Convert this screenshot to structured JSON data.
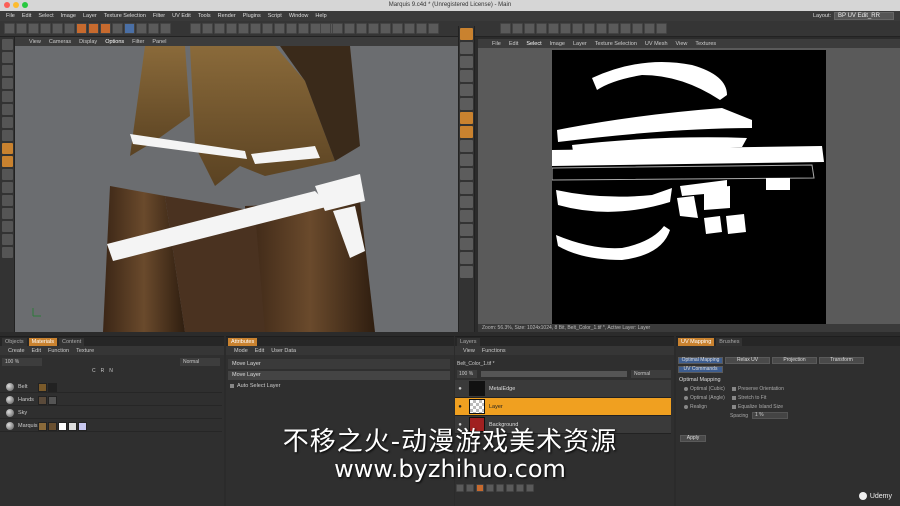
{
  "window": {
    "title": "Marquis 9.c4d * (Unregistered License) - Main"
  },
  "menubar": {
    "items": [
      "File",
      "Edit",
      "Select",
      "Image",
      "Layer",
      "Texture Selection",
      "Filter",
      "UV Edit",
      "Tools",
      "Render",
      "Plugins",
      "Script",
      "Window",
      "Help"
    ],
    "layout_label": "Layout:",
    "layout_value": "BP UV Edit_RR"
  },
  "viewport3d": {
    "menu": [
      "View",
      "Cameras",
      "Display",
      "Options",
      "Filter",
      "Panel"
    ]
  },
  "uv_view": {
    "menu": [
      "File",
      "Edit",
      "Select",
      "Image",
      "Layer",
      "Texture Selection",
      "UV Mesh",
      "View",
      "Textures"
    ],
    "status": "Zoom: 56.3%, Size: 1024x1024, 8 Bit, Belt_Color_1.tif *, Active Layer: Layer"
  },
  "materials_panel": {
    "tabs": [
      "Objects",
      "Materials",
      "Content"
    ],
    "menu": [
      "Create",
      "Edit",
      "Function",
      "Texture"
    ],
    "zoom": "100 %",
    "blend": "Normal",
    "rows": [
      "Belt",
      "Hands",
      "Sky",
      "Marquis"
    ],
    "header_cols": [
      "C",
      "R",
      "N"
    ]
  },
  "attributes_panel": {
    "tabs": [
      "Attributes"
    ],
    "menu": [
      "Mode",
      "Edit",
      "User Data"
    ],
    "title": "Move Layer",
    "field": "Move Layer",
    "option": "Auto Select Layer"
  },
  "layers_panel": {
    "tab": "Layers",
    "menu": [
      "View",
      "Functions"
    ],
    "file": "Belt_Color_1.tif *",
    "opacity": "100 %",
    "blend": "Normal",
    "layers": [
      "MetalEdge",
      "Layer",
      "Background"
    ]
  },
  "uv_mapping_panel": {
    "tabs": [
      "UV Mapping",
      "Brushes"
    ],
    "buttons": [
      "Optimal Mapping",
      "Relax UV",
      "Projection",
      "Transform"
    ],
    "sub_tab": "UV Commands",
    "section": "Optimal Mapping",
    "opt1": "Optimal (Cubic)",
    "opt2": "Optimal (Angle)",
    "opt3": "Realign",
    "checks": [
      "Preserve Orientation",
      "Stretch to Fit",
      "Equalize Island Size"
    ],
    "spacing_label": "Spacing",
    "spacing_value": "1 %",
    "apply": "Apply"
  },
  "watermark": {
    "line1": "不移之火-动漫游戏美术资源",
    "line2": "www.byzhihuo.com"
  },
  "brand": "Udemy",
  "colors": {
    "accent": "#c9822f",
    "active_layer": "#f0a020"
  }
}
